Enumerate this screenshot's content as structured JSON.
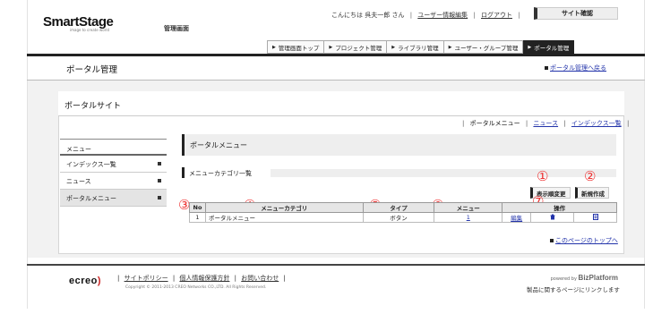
{
  "header": {
    "brand": "SmartStage",
    "brand_tagline": "image to create world",
    "admin_label": "管理画面",
    "greeting": "こんにちは 呉夫一郎 さん",
    "links": [
      "ユーザー情報編集",
      "ログアウト"
    ],
    "site_button": "サイト確認"
  },
  "global_nav": [
    {
      "label": "管理画面トップ",
      "active": false
    },
    {
      "label": "プロジェクト管理",
      "active": false
    },
    {
      "label": "ライブラリ管理",
      "active": false
    },
    {
      "label": "ユーザー・グループ管理",
      "active": false
    },
    {
      "label": "ポータル管理",
      "active": true
    }
  ],
  "page": {
    "title": "ポータル管理",
    "back_link": "ポータル管理へ戻る"
  },
  "panel": {
    "title": "ポータルサイト",
    "subnav": {
      "current": "ポータルメニュー",
      "links": [
        "ニュース",
        "インデックス一覧"
      ]
    }
  },
  "left_menu": {
    "header": "メニュー",
    "items": [
      {
        "label": "インデックス一覧",
        "active": false
      },
      {
        "label": "ニュース",
        "active": false
      },
      {
        "label": "ポータルメニュー",
        "active": true
      }
    ]
  },
  "main": {
    "heading": "ポータルメニュー",
    "category_heading": "メニューカテゴリ一覧",
    "buttons": {
      "order": "表示順変更",
      "new": "新規作成"
    },
    "markers": [
      "①",
      "②",
      "③",
      "④",
      "⑤",
      "⑥",
      "⑦"
    ],
    "table": {
      "columns": [
        "No",
        "メニューカテゴリ",
        "タイプ",
        "メニュー",
        "操作"
      ],
      "rows": [
        {
          "no": "1",
          "category": "ポータルメニュー",
          "type": "ボタン",
          "menu": "1",
          "edit": "編集",
          "delete_icon": "trash-icon",
          "view_icon": "view-icon"
        }
      ]
    },
    "top_link": "このページのトップへ"
  },
  "footer": {
    "logo": "ecreo",
    "links": [
      "サイトポリシー",
      "個人情報保護方針",
      "お問い合わせ"
    ],
    "copyright": "Copyright © 2011-2013 CREO Networks CO.,LTD. All Rights Reserved.",
    "powered_by": "powered by",
    "platform": "BizPlatform",
    "note": "製品に関するページにリンクします"
  }
}
